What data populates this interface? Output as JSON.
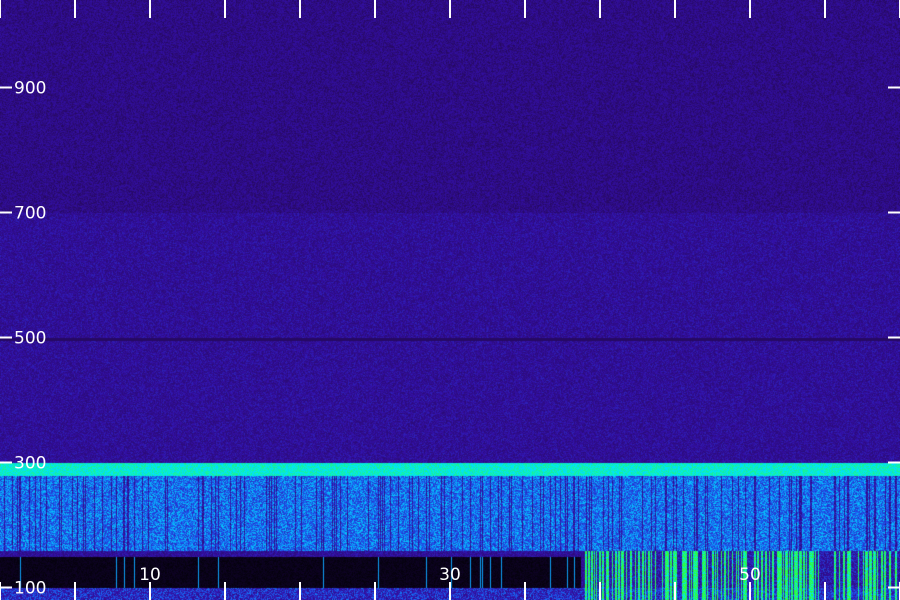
{
  "chart_data": {
    "type": "heatmap",
    "title": "",
    "xlabel": "",
    "ylabel": "",
    "xlim": [
      0,
      60
    ],
    "ylim": [
      80,
      1040
    ],
    "x_ticks": [
      0,
      5,
      10,
      15,
      20,
      25,
      30,
      35,
      40,
      45,
      50,
      55,
      60
    ],
    "x_tick_labels": [
      {
        "value": 10,
        "label": "10"
      },
      {
        "value": 30,
        "label": "30"
      },
      {
        "value": 50,
        "label": "50"
      }
    ],
    "y_ticks": [
      {
        "value": 100,
        "label": "100"
      },
      {
        "value": 300,
        "label": "300"
      },
      {
        "value": 500,
        "label": "500"
      },
      {
        "value": 700,
        "label": "700"
      },
      {
        "value": 900,
        "label": "900"
      }
    ],
    "colormap": [
      "#000000",
      "#2a0a6e",
      "#3310a8",
      "#1a5cf0",
      "#00e5ff",
      "#2dff3a"
    ],
    "features": [
      {
        "name": "low-frequency energy band",
        "y_range": [
          160,
          300
        ],
        "x_range": [
          0,
          60
        ],
        "level": 0.62
      },
      {
        "name": "band edge",
        "y_range": [
          280,
          300
        ],
        "x_range": [
          0,
          60
        ],
        "level": 0.85
      },
      {
        "name": "dark gap",
        "y_range": [
          100,
          150
        ],
        "x_range": [
          0,
          38.7
        ],
        "level": 0.0
      },
      {
        "name": "hum line",
        "y_range": [
          495,
          500
        ],
        "x_range": [
          0,
          60
        ],
        "level": 0.45
      },
      {
        "name": "broadband bursts",
        "y_range": [
          80,
          150
        ],
        "x_range": [
          39,
          60
        ],
        "level": 0.95
      }
    ],
    "grid": false,
    "legend": "none"
  }
}
